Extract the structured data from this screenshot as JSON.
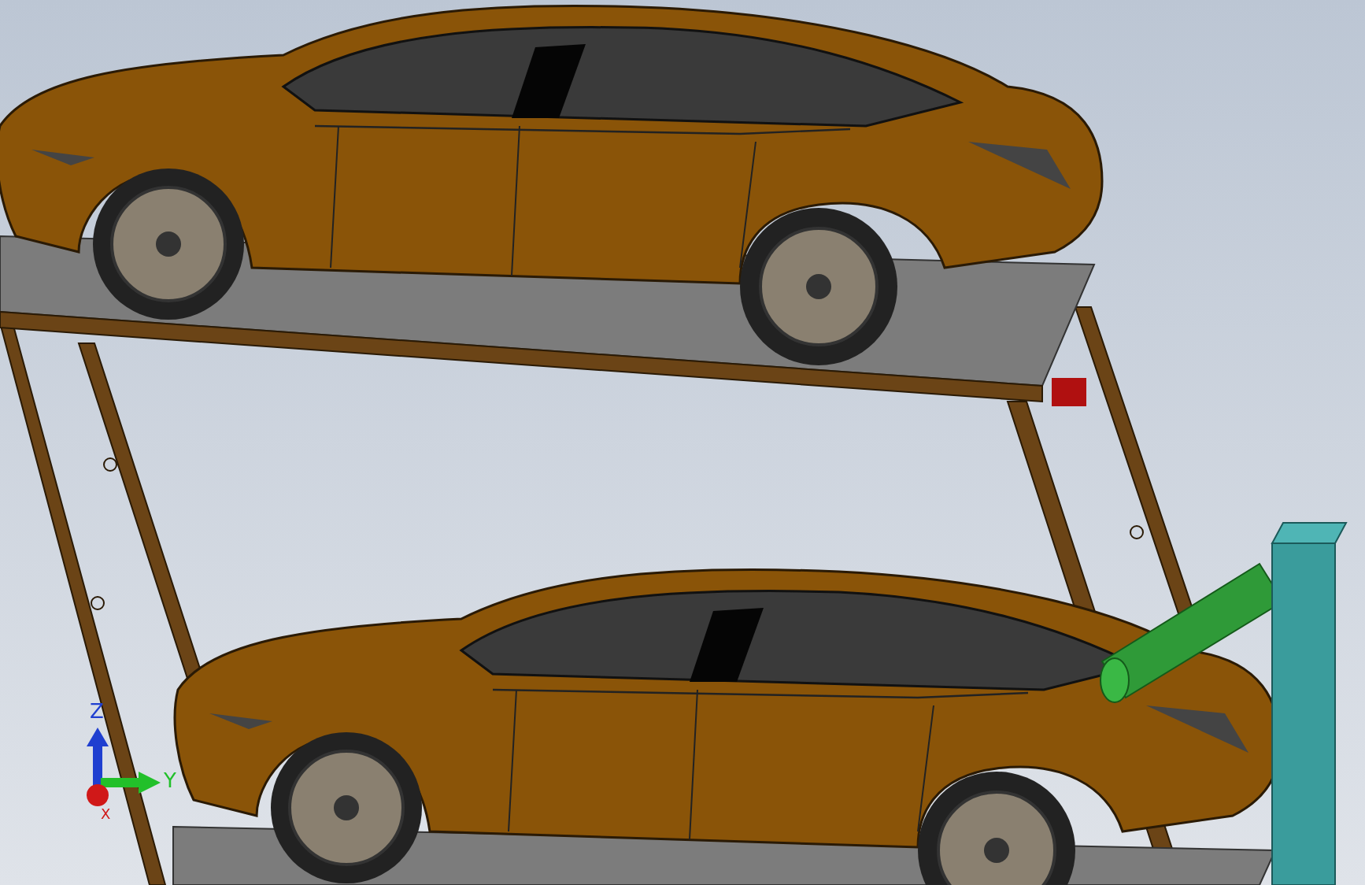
{
  "triad": {
    "axes": [
      {
        "kind": "z",
        "label": "Z",
        "color": "#1f3fd0"
      },
      {
        "kind": "y",
        "label": "Y",
        "color": "#22c02a"
      },
      {
        "kind": "x",
        "label": "X",
        "color": "#d01818"
      }
    ]
  }
}
